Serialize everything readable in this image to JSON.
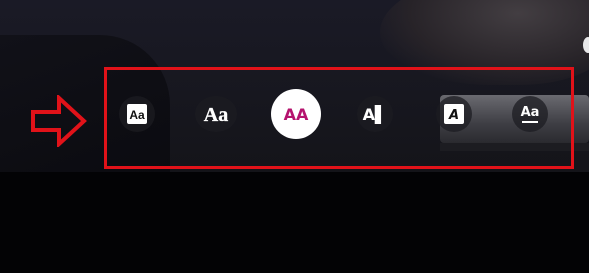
{
  "font_styles": [
    {
      "label": "Aa",
      "style": "classic",
      "selected": false
    },
    {
      "label": "Aa",
      "style": "typewriter-serif",
      "selected": false
    },
    {
      "label": "AA",
      "style": "strong",
      "selected": true
    },
    {
      "label": "A▌",
      "style": "modern",
      "selected": false
    },
    {
      "label": "A",
      "style": "italic-box",
      "selected": false
    },
    {
      "label": "Aa",
      "style": "underline",
      "selected": false
    }
  ],
  "colors": {
    "highlight_border": "#e11219",
    "arrow_outline": "#e11219",
    "selected_text": "#b5136e",
    "selected_background": "#ffffff"
  },
  "icons": {
    "arrow": "right-arrow-outline-icon"
  }
}
